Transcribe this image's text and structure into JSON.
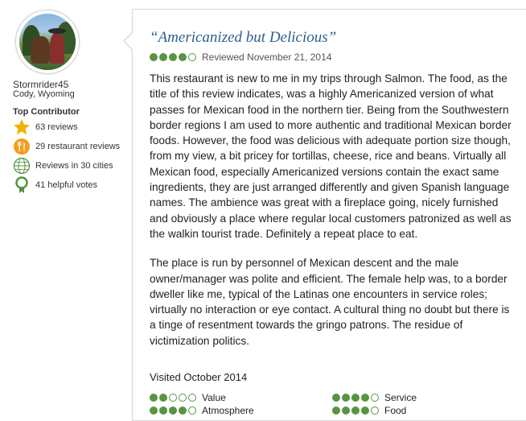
{
  "user": {
    "username": "Stormrider45",
    "hometown": "Cody, Wyoming",
    "contributor_title": "Top Contributor",
    "badges": [
      {
        "icon": "star-icon",
        "label": "63 reviews"
      },
      {
        "icon": "fork-knife-icon",
        "label": "29 restaurant reviews"
      },
      {
        "icon": "globe-icon",
        "label": "Reviews in 30 cities"
      },
      {
        "icon": "ribbon-icon",
        "label": "41 helpful votes"
      }
    ]
  },
  "review": {
    "title": "“Americanized but Delicious”",
    "rating": 4,
    "rating_max": 5,
    "date_text": "Reviewed November 21, 2014",
    "paragraphs": [
      "This restaurant is new to me in my trips through Salmon. The food, as the title of this review indicates, was a highly Americanized version of what passes for Mexican food in the northern tier. Being from the Southwestern border regions I am used to more authentic and traditional Mexican border foods. However, the food was delicious with adequate portion size though, from my view, a bit pricey for tortillas, cheese, rice and beans. Virtually all Mexican food, especially Americanized versions contain the exact same ingredients, they are just arranged differently and given Spanish language names. The ambience was great with a fireplace going, nicely furnished and obviously a place where regular local customers patronized as well as the walkin tourist trade. Definitely a repeat place to eat.",
      "The place is run by personnel of Mexican descent and the male owner/manager was polite and efficient. The female help was, to a border dweller like me, typical of the Latinas one encounters in service roles; virtually no interaction or eye contact. A cultural thing no doubt but there is a tinge of resentment towards the gringo patrons. The residue of victimization politics."
    ],
    "visited": "Visited October 2014",
    "sub_ratings": [
      {
        "label": "Value",
        "rating": 2
      },
      {
        "label": "Service",
        "rating": 4
      },
      {
        "label": "Atmosphere",
        "rating": 4
      },
      {
        "label": "Food",
        "rating": 4
      }
    ]
  },
  "colors": {
    "bubble_green": "#589442",
    "title_blue": "#2c5f8a",
    "star_gold": "#f2b203",
    "badge_orange": "#f59b1b",
    "badge_green": "#589442"
  }
}
